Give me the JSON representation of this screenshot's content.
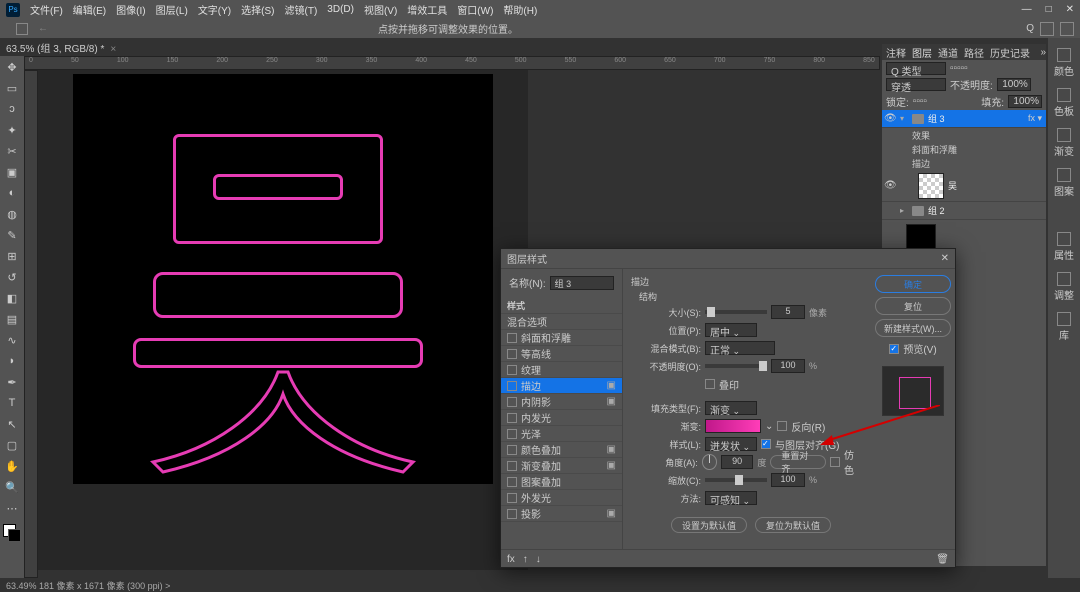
{
  "menu": {
    "items": [
      "文件(F)",
      "编辑(E)",
      "图像(I)",
      "图层(L)",
      "文字(Y)",
      "选择(S)",
      "滤镜(T)",
      "3D(D)",
      "视图(V)",
      "增效工具",
      "窗口(W)",
      "帮助(H)"
    ]
  },
  "hint": "点按并拖移可调整效果的位置。",
  "doc_tab": "63.5% (组 3, RGB/8) *",
  "ruler": [
    "0",
    "50",
    "100",
    "150",
    "200",
    "250",
    "300",
    "350",
    "400",
    "450",
    "500",
    "550",
    "600",
    "650",
    "700",
    "750",
    "800",
    "850"
  ],
  "right_tools": [
    "颜色",
    "色板",
    "渐变",
    "图案",
    "属性",
    "调整",
    "库"
  ],
  "panel_tabs": [
    "注释",
    "图层",
    "通道",
    "路径",
    "历史记录"
  ],
  "layer_ctrl": {
    "kind": "Q 类型",
    "normal": "穿透",
    "opacity_label": "不透明度:",
    "opacity": "100%",
    "lock": "锁定:",
    "fill_label": "填充:",
    "fill": "100%"
  },
  "layers": {
    "g3": "组 3",
    "fx": "效果",
    "bevel": "斜面和浮雕",
    "stroke": "描边",
    "wu": "吴",
    "g2": "组 2"
  },
  "status": "63.49% 181 像素 x 1671 像素 (300 ppi)  >",
  "dialog": {
    "title": "图层样式",
    "name_label": "名称(N):",
    "name_value": "组 3",
    "styles_header": "样式",
    "styles": [
      "混合选项",
      "斜面和浮雕",
      "等高线",
      "纹理",
      "描边",
      "内阴影",
      "内发光",
      "光泽",
      "颜色叠加",
      "渐变叠加",
      "图案叠加",
      "外发光",
      "投影"
    ],
    "section": "描边",
    "struct": "结构",
    "size_label": "大小(S):",
    "size": "5",
    "size_unit": "像素",
    "pos_label": "位置(P):",
    "pos": "居中",
    "blend_label": "混合模式(B):",
    "blend": "正常",
    "op_label": "不透明度(O):",
    "op": "100",
    "op_unit": "%",
    "overprint": "叠印",
    "filltype_label": "填充类型(F):",
    "filltype": "渐变",
    "grad_label": "渐变:",
    "reverse": "反向(R)",
    "style_label": "样式(L):",
    "style": "迸发状",
    "align": "与图层对齐(G)",
    "angle_label": "角度(A):",
    "angle": "90",
    "angle_unit": "度",
    "reset_align": "重置对齐",
    "dither": "仿色",
    "scale_label": "缩放(C):",
    "scale": "100",
    "scale_unit": "%",
    "method_label": "方法:",
    "method": "可感知",
    "btn_default": "设置为默认值",
    "btn_reset_default": "复位为默认值",
    "ok": "确定",
    "cancel": "复位",
    "new_style": "新建样式(W)...",
    "preview": "预览(V)"
  }
}
